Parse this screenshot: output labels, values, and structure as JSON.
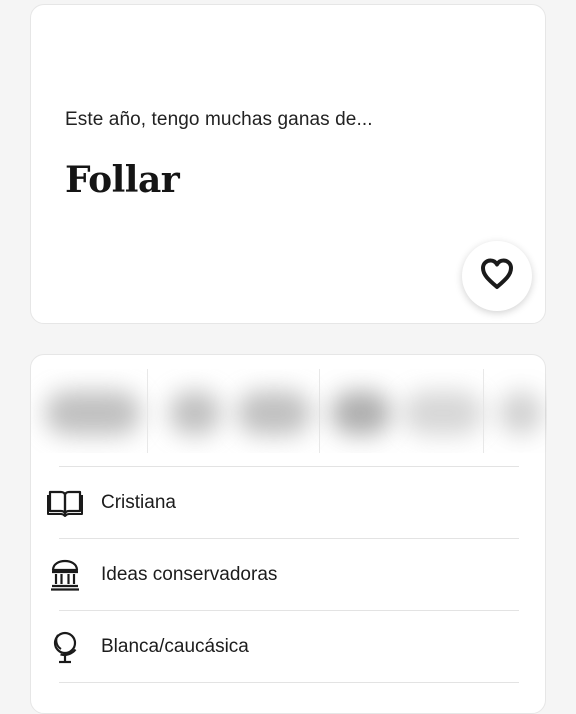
{
  "prompt": {
    "question": "Este año, tengo muchas ganas de...",
    "answer": "Follar",
    "like_icon": "heart-outline-icon"
  },
  "info": {
    "vitals_blurred": true,
    "rows": [
      {
        "icon": "book-icon",
        "label": "Cristiana"
      },
      {
        "icon": "government-building-icon",
        "label": "Ideas conservadoras"
      },
      {
        "icon": "globe-icon",
        "label": "Blanca/caucásica"
      }
    ]
  },
  "colors": {
    "background": "#f5f5f5",
    "card": "#ffffff",
    "text": "#1c1c1c",
    "divider": "#e3e3e3"
  }
}
